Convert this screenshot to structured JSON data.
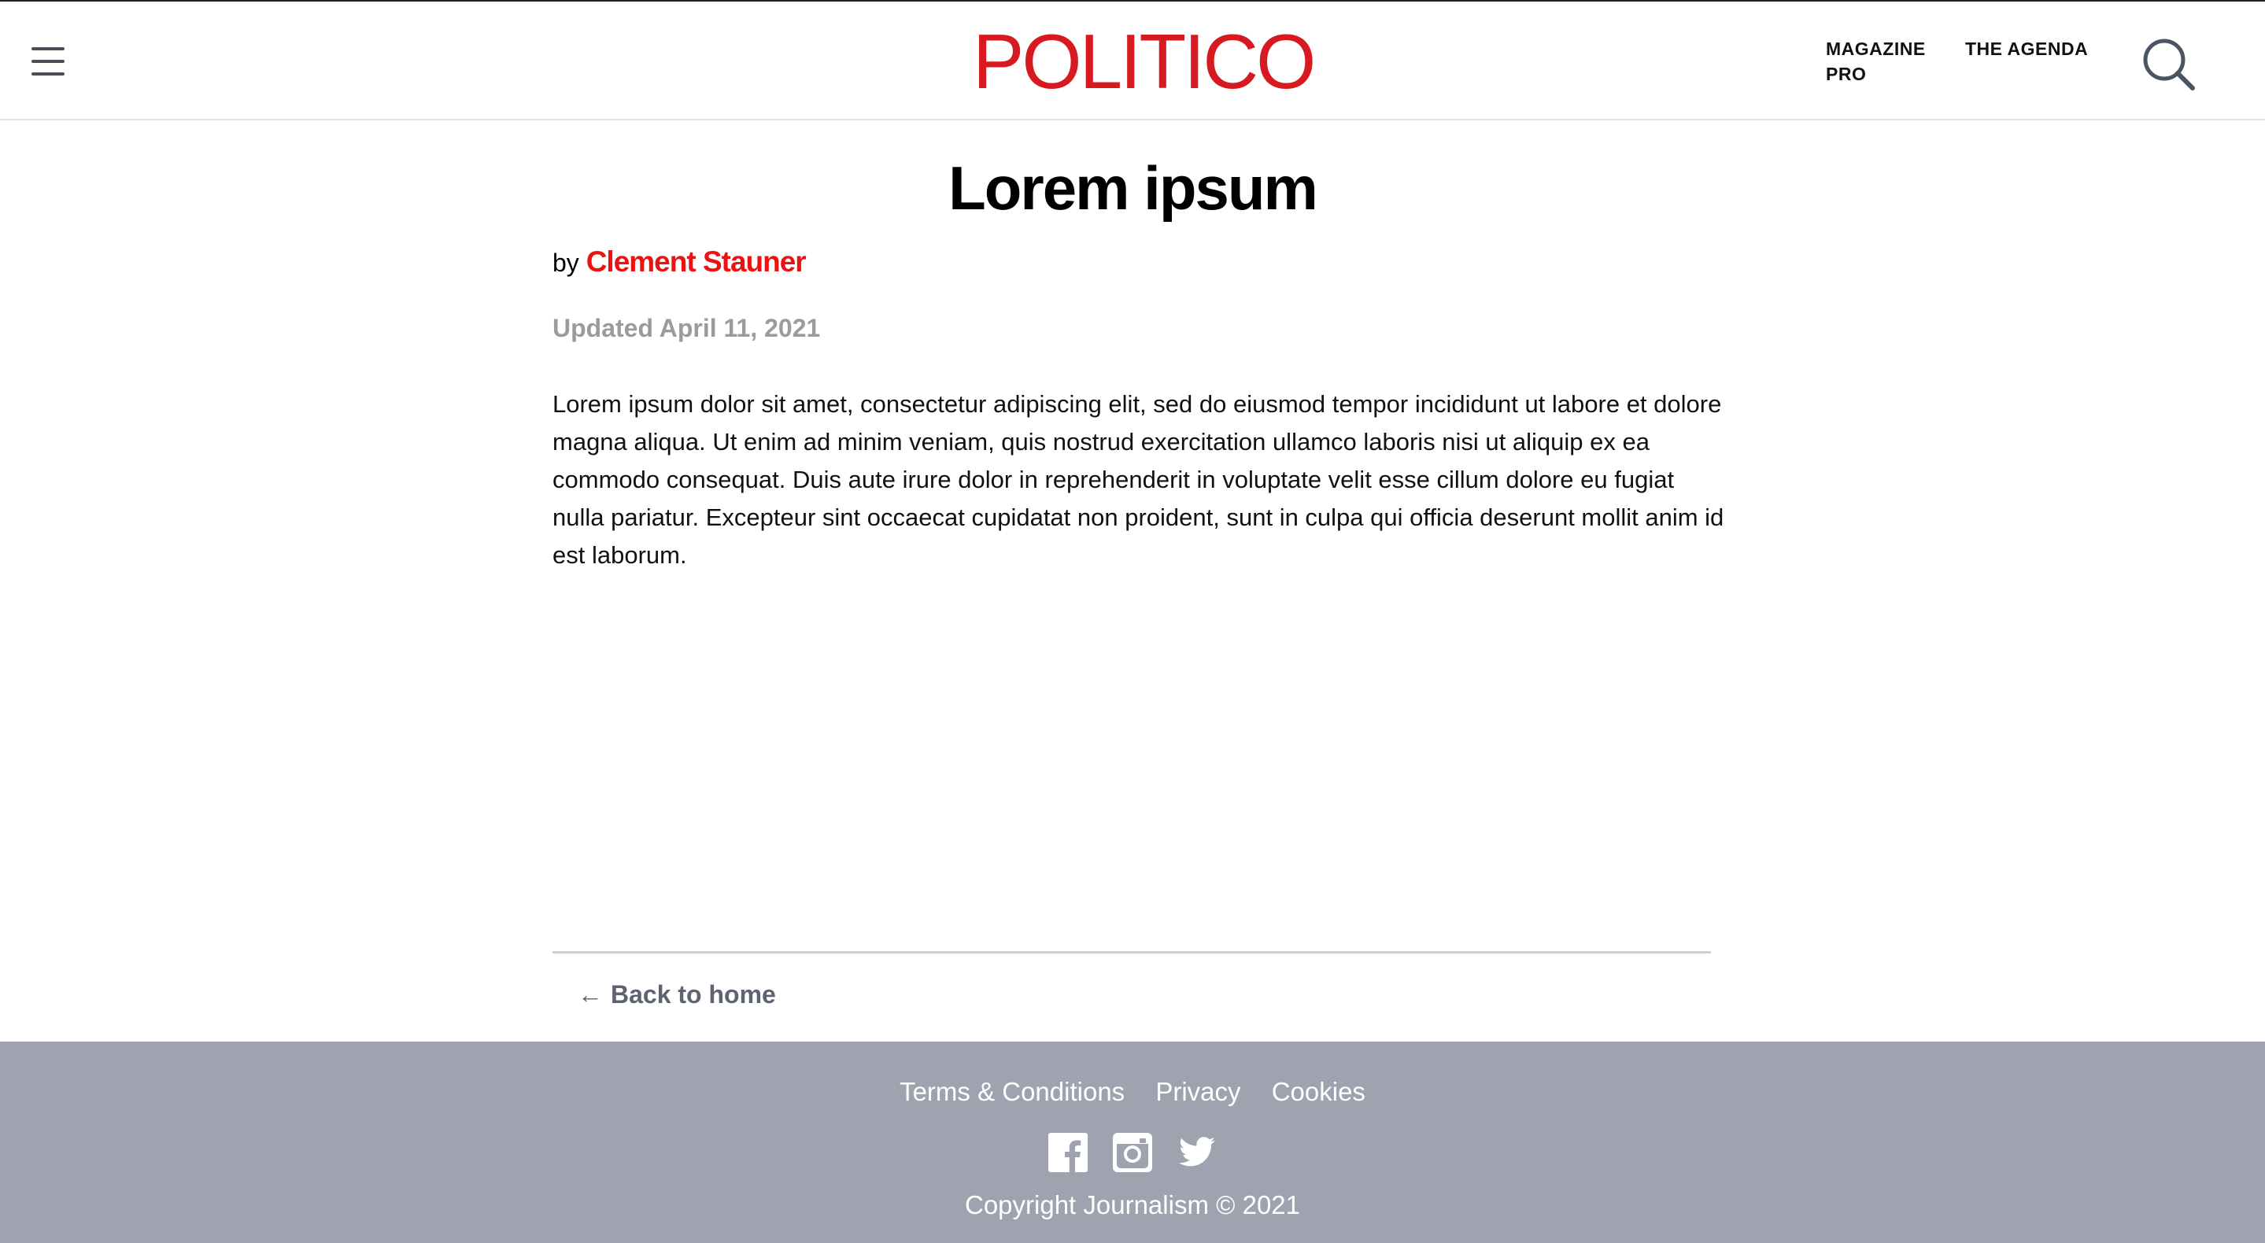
{
  "header": {
    "logo_text": "POLITICO",
    "nav": [
      {
        "label": "MAGAZINE PRO"
      },
      {
        "label": "THE AGENDA"
      }
    ],
    "icons": {
      "menu": "hamburger-menu-icon",
      "search": "search-icon"
    }
  },
  "article": {
    "title": "Lorem ipsum",
    "byline_prefix": "by",
    "author": "Clement Stauner",
    "updated": "Updated April 11, 2021",
    "body": "Lorem ipsum dolor sit amet, consectetur adipiscing elit, sed do eiusmod tempor incididunt ut labore et dolore magna aliqua. Ut enim ad minim veniam, quis nostrud exercitation ullamco laboris nisi ut aliquip ex ea commodo consequat. Duis aute irure dolor in reprehenderit in voluptate velit esse cillum dolore eu fugiat nulla pariatur. Excepteur sint occaecat cupidatat non proident, sunt in culpa qui officia deserunt mollit anim id est laborum.",
    "back_link": "Back to home"
  },
  "footer": {
    "links": [
      {
        "label": "Terms & Conditions"
      },
      {
        "label": "Privacy"
      },
      {
        "label": "Cookies"
      }
    ],
    "social": [
      "facebook-icon",
      "instagram-icon",
      "twitter-icon"
    ],
    "copyright": "Copyright Journalism © 2021"
  },
  "colors": {
    "brand_red": "#d61a1f",
    "author_red": "#ee1111",
    "footer_bg": "#9ea3af",
    "muted_gray": "#9b9b9b"
  }
}
